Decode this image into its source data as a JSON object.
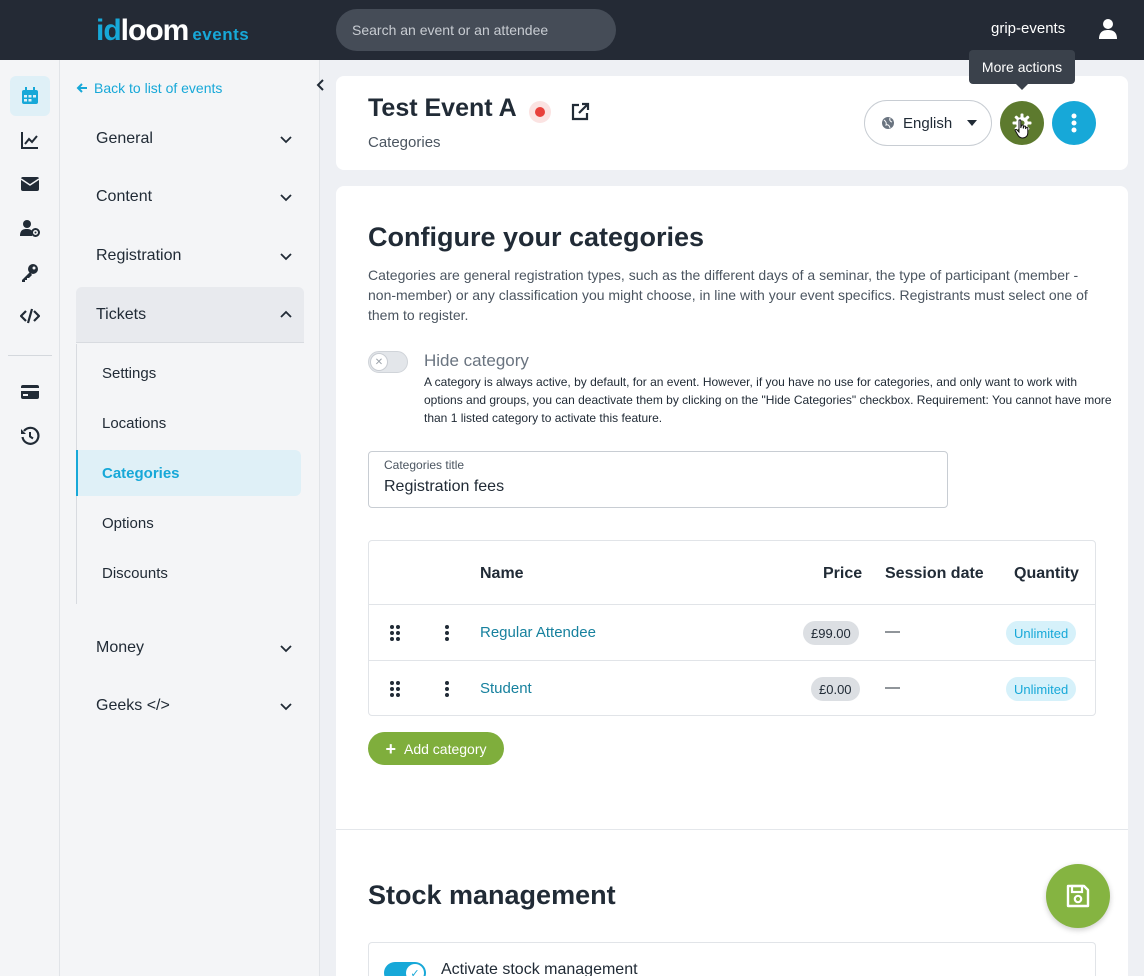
{
  "topbar": {
    "logo_id": "id",
    "logo_loom": "loom",
    "logo_events": "events",
    "search_placeholder": "Search an event or an attendee",
    "username": "grip-events"
  },
  "rail": {
    "items": [
      {
        "icon": "calendar-icon",
        "active": true
      },
      {
        "icon": "chart-line-icon"
      },
      {
        "icon": "envelope-icon"
      },
      {
        "icon": "users-cog-icon"
      },
      {
        "icon": "key-icon"
      },
      {
        "icon": "code-icon"
      },
      {
        "icon": "credit-card-icon"
      },
      {
        "icon": "history-icon"
      }
    ]
  },
  "sidebar": {
    "back_label": "Back to list of events",
    "sections": [
      {
        "label": "General"
      },
      {
        "label": "Content"
      },
      {
        "label": "Registration"
      },
      {
        "label": "Tickets",
        "open": true
      },
      {
        "label": "Money"
      },
      {
        "label": "Geeks </>"
      }
    ],
    "ticket_items": [
      {
        "label": "Settings"
      },
      {
        "label": "Locations"
      },
      {
        "label": "Categories",
        "active": true
      },
      {
        "label": "Options"
      },
      {
        "label": "Discounts"
      }
    ]
  },
  "header": {
    "event_title": "Test Event A",
    "subtitle": "Categories",
    "language": "English",
    "tooltip": "More actions"
  },
  "categories": {
    "heading": "Configure your categories",
    "description": "Categories are general registration types, such as the different days of a seminar, the type of participant (member - non-member) or any classification you might choose, in line with your event specifics. Registrants must select one of them to register.",
    "hide_label": "Hide category",
    "hide_help": "A category is always active, by default, for an event. However, if you have no use for categories, and only want to work with options and groups, you can deactivate them by clicking on the \"Hide Categories\" checkbox. Requirement: You cannot have more than 1 listed category to activate this feature.",
    "title_field_label": "Categories title",
    "title_field_value": "Registration fees",
    "table": {
      "headers": {
        "name": "Name",
        "price": "Price",
        "session_date": "Session date",
        "quantity": "Quantity"
      },
      "rows": [
        {
          "name": "Regular Attendee",
          "price": "£99.00",
          "session_date": "—",
          "quantity": "Unlimited"
        },
        {
          "name": "Student",
          "price": "£0.00",
          "session_date": "—",
          "quantity": "Unlimited"
        }
      ]
    },
    "add_label": "Add category"
  },
  "stock": {
    "heading": "Stock management",
    "activate_label": "Activate stock management"
  },
  "colors": {
    "brand_blue": "#17a8d8",
    "brand_green": "#7fae3c",
    "gear_green": "#5d7a2e",
    "topbar": "#242a35"
  }
}
